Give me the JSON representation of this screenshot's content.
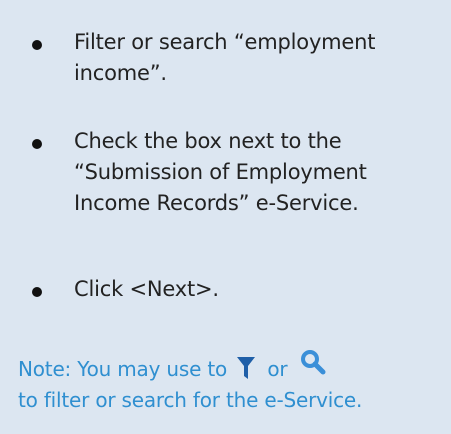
{
  "steps": [
    {
      "text": "Filter or search “employment\nincome”."
    },
    {
      "text": "Check the box next to the\n“Submission of Employment\nIncome Records” e-Service."
    },
    {
      "text": "Click <Next>."
    }
  ],
  "note": {
    "prefix": "Note: You may use to",
    "connector": "or",
    "line2": "to filter or search for the e-Service."
  },
  "icons": {
    "filter": "filter-funnel-icon",
    "search": "magnifier-icon"
  },
  "colors": {
    "panel_background": "#dce6f1",
    "body_text": "#222222",
    "note_text": "#2f8fd0",
    "filter_icon": "#1f5fa8",
    "search_icon": "#3a8fd8"
  }
}
